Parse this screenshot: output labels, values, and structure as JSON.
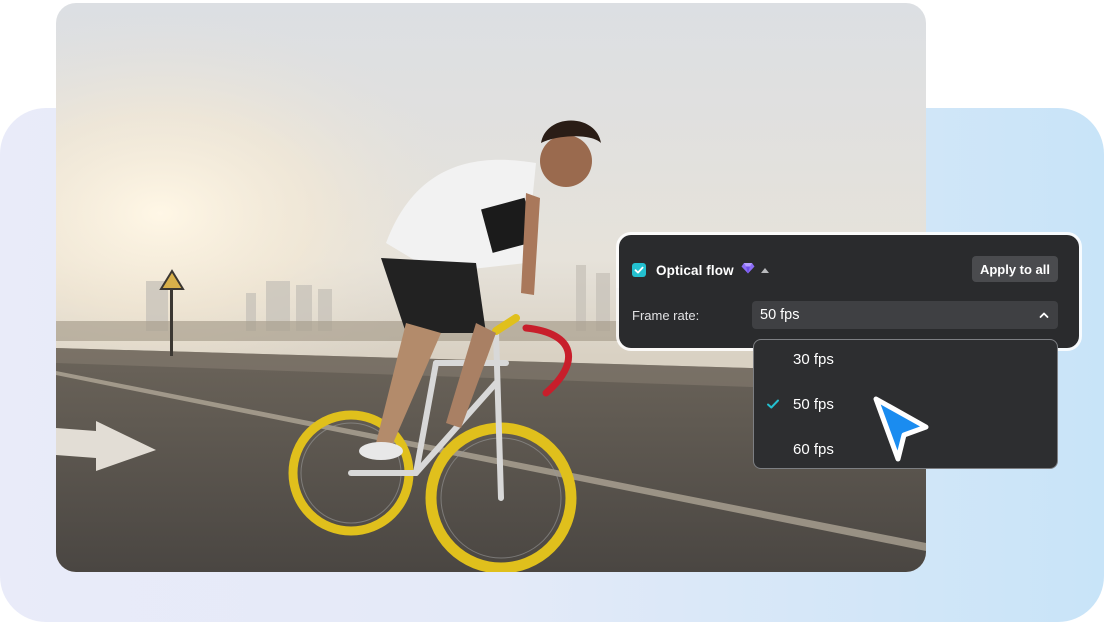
{
  "optical_flow": {
    "label": "Optical flow",
    "checked": true,
    "pro_icon": "gem-icon",
    "apply_button": "Apply to all"
  },
  "frame_rate": {
    "label": "Frame rate:",
    "selected": "50 fps",
    "options": [
      "30 fps",
      "50 fps",
      "60 fps"
    ],
    "selected_index": 1
  },
  "colors": {
    "accent": "#23c0cf",
    "panel_bg": "#2a2b2d",
    "cursor": "#1a8cf0"
  }
}
